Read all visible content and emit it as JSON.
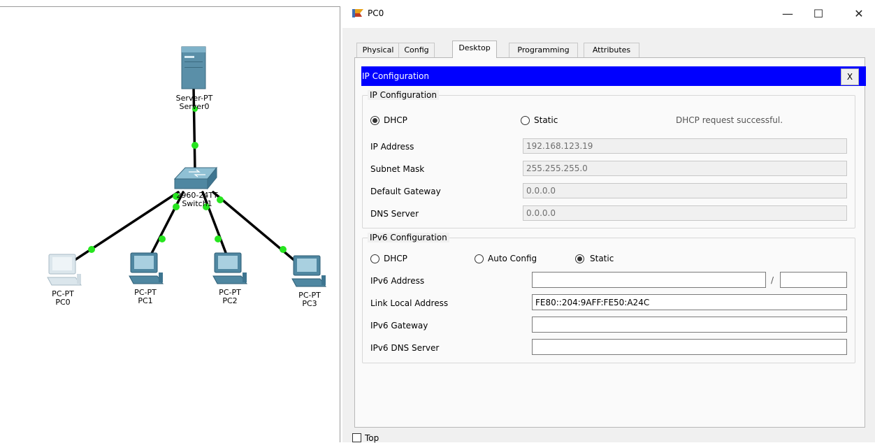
{
  "topology": {
    "devices": [
      {
        "name": "PC0",
        "type": "PC-PT",
        "selected": true
      },
      {
        "name": "PC1",
        "type": "PC-PT"
      },
      {
        "name": "PC2",
        "type": "PC-PT"
      },
      {
        "name": "PC3",
        "type": "PC-PT"
      }
    ],
    "server": {
      "type": "Server-PT",
      "name": "Server0"
    },
    "switch": {
      "type": "2960-24TT",
      "name": "Switch1"
    },
    "link_color": "#000000",
    "link_light_color": "#27e51f"
  },
  "window": {
    "title": "PC0",
    "minimize_label": "—",
    "maximize_label": "☐",
    "close_label": "✕",
    "tabs": [
      "Physical",
      "Config",
      "Desktop",
      "Programming",
      "Attributes"
    ],
    "active_tab": "Desktop",
    "top_label": "Top"
  },
  "ip_config": {
    "bar_title": "IP Configuration",
    "close_label": "X",
    "ipv4": {
      "title": "IP Configuration",
      "dhcp_label": "DHCP",
      "static_label": "Static",
      "mode": "DHCP",
      "status": "DHCP request successful.",
      "ip_label": "IP Address",
      "ip_value": "192.168.123.19",
      "mask_label": "Subnet Mask",
      "mask_value": "255.255.255.0",
      "gateway_label": "Default Gateway",
      "gateway_value": "0.0.0.0",
      "dns_label": "DNS Server",
      "dns_value": "0.0.0.0"
    },
    "ipv6": {
      "title": "IPv6 Configuration",
      "dhcp_label": "DHCP",
      "auto_label": "Auto Config",
      "static_label": "Static",
      "mode": "Static",
      "address_label": "IPv6 Address",
      "address_value": "",
      "prefix_sep": "/",
      "prefix_value": "",
      "link_local_label": "Link Local Address",
      "link_local_value": "FE80::204:9AFF:FE50:A24C",
      "gateway_label": "IPv6 Gateway",
      "gateway_value": "",
      "dns_label": "IPv6 DNS Server",
      "dns_value": ""
    }
  },
  "colors": {
    "ip_bar": "#0000ff",
    "window_bg": "#f0f0f0"
  }
}
